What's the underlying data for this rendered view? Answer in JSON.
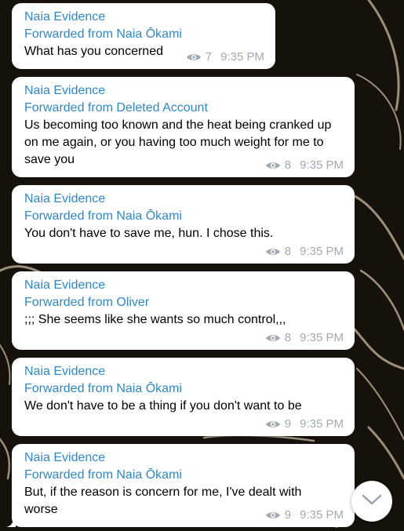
{
  "messages": [
    {
      "sender": "Naia Evidence",
      "forwarded": "Forwarded from Naia Ōkami",
      "text": "What has you concerned",
      "views": "7",
      "time": "9:35 PM"
    },
    {
      "sender": "Naia Evidence",
      "forwarded": "Forwarded from Deleted Account",
      "text": "Us becoming too known and the heat being cranked up on me again, or you having too much weight for me to save you",
      "views": "8",
      "time": "9:35 PM"
    },
    {
      "sender": "Naia Evidence",
      "forwarded": "Forwarded from Naia Ōkami",
      "text": "You don't have to save me, hun. I chose this.",
      "views": "8",
      "time": "9:35 PM"
    },
    {
      "sender": "Naia Evidence",
      "forwarded": "Forwarded from Oliver",
      "text": ";;; She seems like she wants so much control,,,",
      "views": "8",
      "time": "9:35 PM"
    },
    {
      "sender": "Naia Evidence",
      "forwarded": "Forwarded from Naia Ōkami",
      "text": "We don't have to be a thing if you don't want to be",
      "views": "9",
      "time": "9:35 PM"
    },
    {
      "sender": "Naia Evidence",
      "forwarded": "Forwarded from Naia Ōkami",
      "text": "But, if the reason is concern for me, I've dealt with worse",
      "views": "9",
      "time": "9:35 PM"
    }
  ],
  "icons": {
    "views": "eye-icon",
    "scroll": "chevron-down-icon"
  },
  "colors": {
    "name": "#2f88c6",
    "meta": "#a1aab3",
    "bubble": "#ffffff",
    "background": "#15100c"
  }
}
